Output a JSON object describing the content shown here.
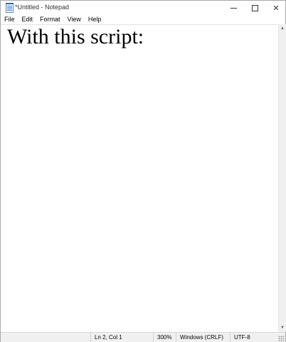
{
  "window": {
    "title": "*Untitled - Notepad",
    "controls": {
      "minimize_icon": "minimize-icon",
      "maximize_icon": "maximize-icon",
      "close_icon": "close-icon",
      "close_glyph": "✕"
    }
  },
  "menu": {
    "items": [
      {
        "label": "File"
      },
      {
        "label": "Edit"
      },
      {
        "label": "Format"
      },
      {
        "label": "View"
      },
      {
        "label": "Help"
      }
    ]
  },
  "editor": {
    "text": "With this script:"
  },
  "scrollbar": {
    "up_glyph": "▲",
    "down_glyph": "▼"
  },
  "statusbar": {
    "position": "Ln 2, Col 1",
    "zoom": "300%",
    "line_ending": "Windows (CRLF)",
    "encoding": "UTF-8"
  }
}
